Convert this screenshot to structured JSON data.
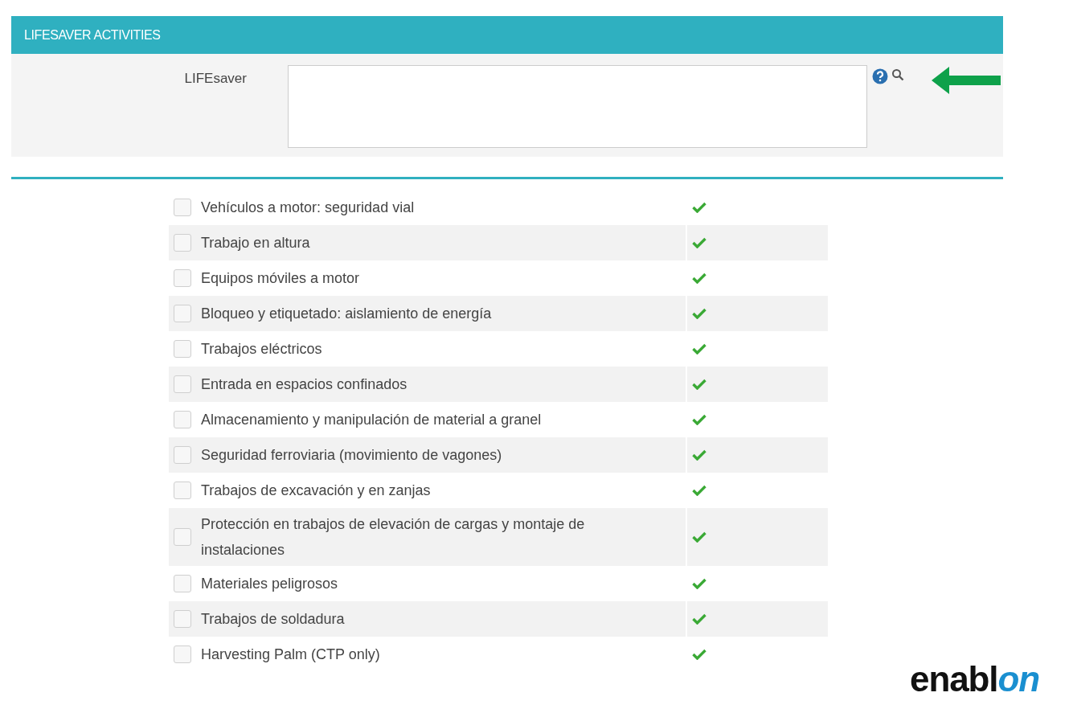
{
  "section": {
    "title": "LIFESAVER ACTIVITIES"
  },
  "form": {
    "label": "LIFEsaver"
  },
  "activities": [
    {
      "label": "Vehículos a motor: seguridad vial",
      "checked": false,
      "approved": true
    },
    {
      "label": "Trabajo en altura",
      "checked": false,
      "approved": true
    },
    {
      "label": "Equipos móviles a motor",
      "checked": false,
      "approved": true
    },
    {
      "label": "Bloqueo y etiquetado: aislamiento de energía",
      "checked": false,
      "approved": true
    },
    {
      "label": "Trabajos eléctricos",
      "checked": false,
      "approved": true
    },
    {
      "label": "Entrada en espacios confinados",
      "checked": false,
      "approved": true
    },
    {
      "label": "Almacenamiento y manipulación de material a granel",
      "checked": false,
      "approved": true
    },
    {
      "label": "Seguridad ferroviaria (movimiento de vagones)",
      "checked": false,
      "approved": true
    },
    {
      "label": "Trabajos de excavación y en zanjas",
      "checked": false,
      "approved": true
    },
    {
      "label": "Protección en trabajos de elevación de cargas y montaje de instalaciones",
      "checked": false,
      "approved": true
    },
    {
      "label": "Materiales peligrosos",
      "checked": false,
      "approved": true
    },
    {
      "label": "Trabajos de soldadura",
      "checked": false,
      "approved": true
    },
    {
      "label": "Harvesting Palm (CTP only)",
      "checked": false,
      "approved": true
    }
  ],
  "logo": {
    "text": "enabl",
    "accent": "on"
  }
}
